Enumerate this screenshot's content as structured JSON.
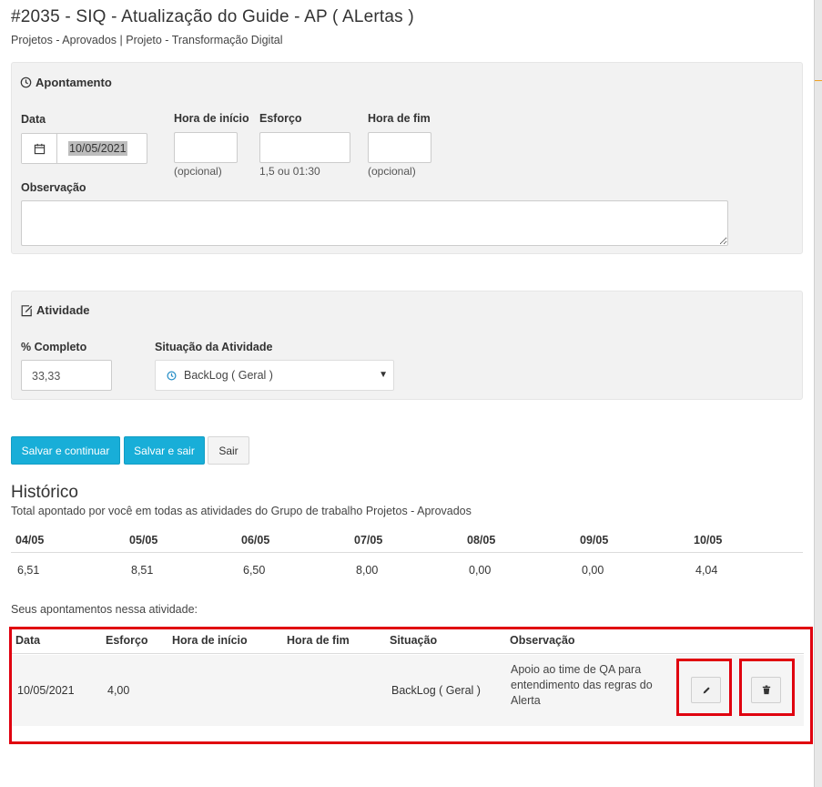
{
  "header": {
    "title": "#2035 - SIQ - Atualização do Guide - AP ( ALertas )",
    "subtitle": "Projetos - Aprovados | Projeto - Transformação Digital"
  },
  "apontamento": {
    "heading": "Apontamento",
    "icon": "clock-icon",
    "data_label": "Data",
    "data_value": "10/05/2021",
    "hora_inicio_label": "Hora de início",
    "hora_inicio_value": "",
    "hora_inicio_hint": "(opcional)",
    "esforco_label": "Esforço",
    "esforco_value": "",
    "esforco_hint": "1,5 ou 01:30",
    "hora_fim_label": "Hora de fim",
    "hora_fim_value": "",
    "hora_fim_hint": "(opcional)",
    "observacao_label": "Observação",
    "observacao_value": ""
  },
  "atividade": {
    "heading": "Atividade",
    "icon": "edit-icon",
    "completo_label": "% Completo",
    "completo_value": "33,33",
    "situacao_label": "Situação da Atividade",
    "situacao_value": "BackLog ( Geral )"
  },
  "buttons": {
    "save_continue": "Salvar e continuar",
    "save_exit": "Salvar e sair",
    "exit": "Sair"
  },
  "historico": {
    "title": "Histórico",
    "subtitle": "Total apontado por você em todas as atividades do Grupo de trabalho Projetos - Aprovados",
    "days": [
      {
        "date": "04/05",
        "value": "6,51"
      },
      {
        "date": "05/05",
        "value": "8,51"
      },
      {
        "date": "06/05",
        "value": "6,50"
      },
      {
        "date": "07/05",
        "value": "8,00"
      },
      {
        "date": "08/05",
        "value": "0,00"
      },
      {
        "date": "09/05",
        "value": "0,00"
      },
      {
        "date": "10/05",
        "value": "4,04"
      }
    ]
  },
  "meus": {
    "label": "Seus apontamentos nessa atividade:",
    "columns": {
      "data": "Data",
      "esforco": "Esforço",
      "hora_inicio": "Hora de início",
      "hora_fim": "Hora de fim",
      "situacao": "Situação",
      "observacao": "Observação"
    },
    "rows": [
      {
        "data": "10/05/2021",
        "esforco": "4,00",
        "hora_inicio": "",
        "hora_fim": "",
        "situacao": "BackLog ( Geral )",
        "observacao": "Apoio ao time de QA para entendimento das regras do Alerta"
      }
    ]
  },
  "colors": {
    "primary": "#18aed8",
    "highlight": "#e0000f",
    "panel": "#f2f2f2"
  }
}
